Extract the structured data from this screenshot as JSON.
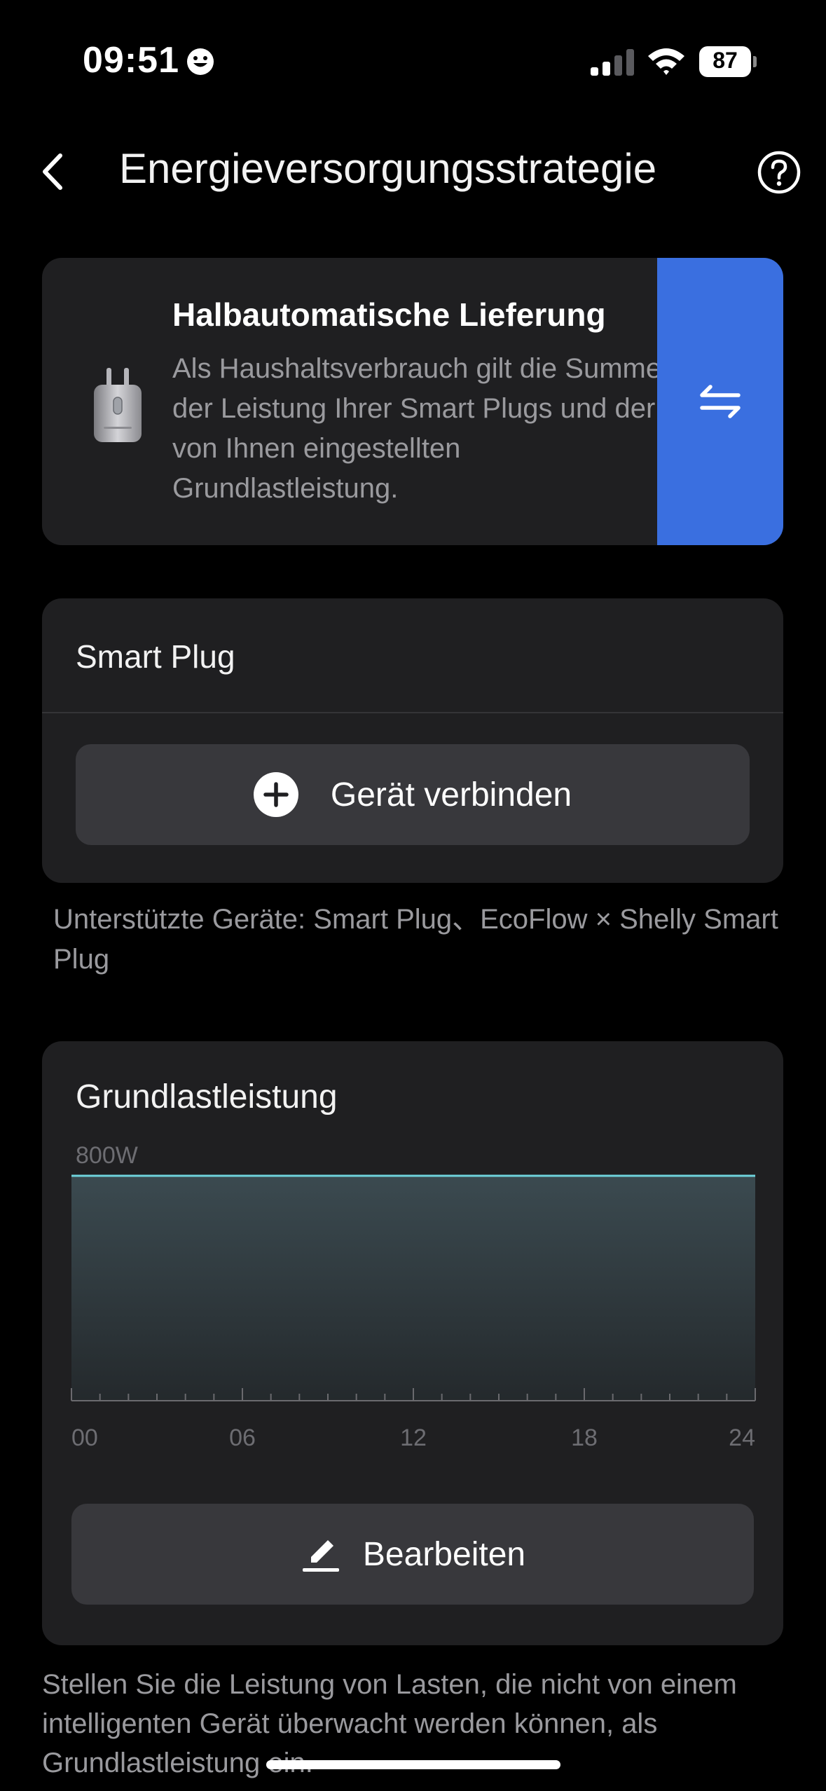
{
  "status_bar": {
    "time": "09:51",
    "battery": "87",
    "icons": [
      "smiley-icon",
      "signal-icon",
      "wifi-icon",
      "battery-icon"
    ]
  },
  "header": {
    "title": "Energieversorgungsstrategie",
    "icons": [
      "chevron-left-icon",
      "help-icon"
    ]
  },
  "strategy": {
    "title": "Halbautomatische Lieferung",
    "description": "Als Haushaltsverbrauch gilt die Summe der Leistung Ihrer Smart Plugs und der von Ihnen eingestellten Grundlastleistung.",
    "icons": [
      "smart-plug-icon",
      "switch-arrows-icon"
    ],
    "accent_color": "#3a6fe0"
  },
  "smart_plug": {
    "title": "Smart Plug",
    "connect_label": "Gerät verbinden",
    "supported": "Unterstützte Geräte: Smart Plug、EcoFlow × Shelly Smart Plug"
  },
  "base_load": {
    "title": "Grundlastleistung",
    "edit_label": "Bearbeiten"
  },
  "chart_data": {
    "type": "area",
    "title": "",
    "xlabel": "",
    "ylabel": "",
    "y_tick_label": "800W",
    "x_ticks": [
      "00",
      "06",
      "12",
      "18",
      "24"
    ],
    "x": [
      0,
      24
    ],
    "values": [
      800,
      800
    ],
    "ylim": [
      0,
      800
    ],
    "xlim": [
      0,
      24
    ],
    "grid": false,
    "line_color": "#6fd3dc"
  },
  "footer": {
    "text": "Stellen Sie die Leistung von Lasten, die nicht von einem intelligenten Gerät überwacht werden können, als Grundlastleistung ein."
  }
}
